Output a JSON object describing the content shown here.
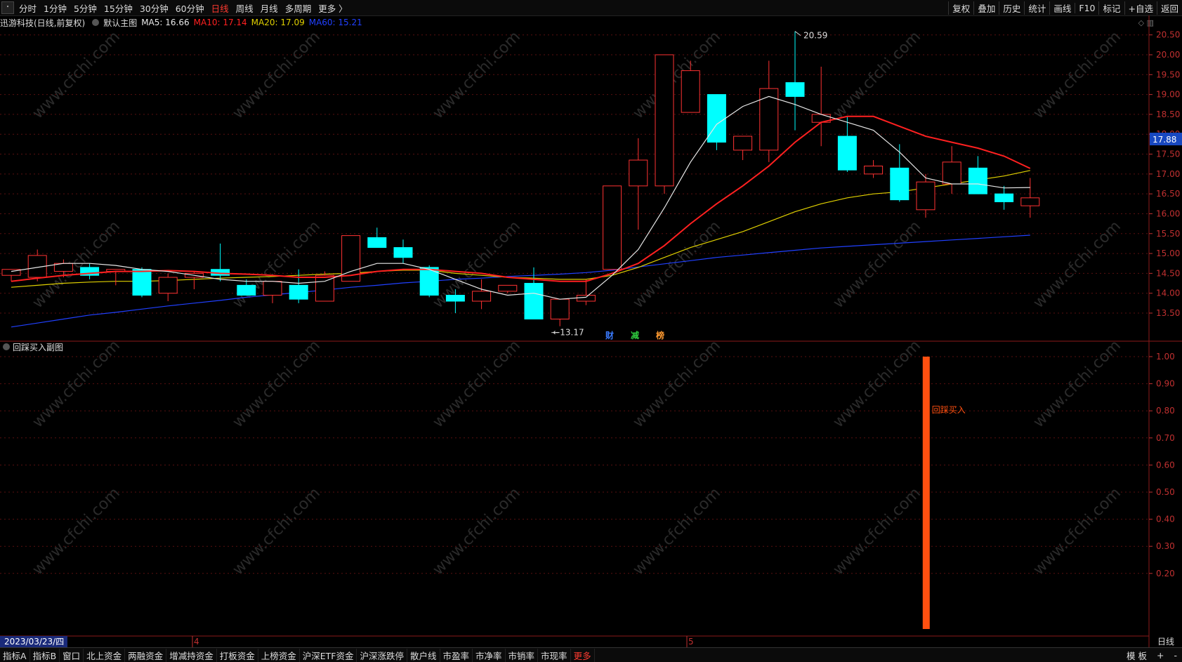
{
  "toolbar": {
    "corner": "・",
    "tabs": [
      "分时",
      "1分钟",
      "5分钟",
      "15分钟",
      "30分钟",
      "60分钟",
      "日线",
      "周线",
      "月线",
      "多周期",
      "更多 〉"
    ],
    "active_tab": "日线",
    "right_buttons": [
      "复权",
      "叠加",
      "历史",
      "统计",
      "画线",
      "F10",
      "标记",
      "+自选",
      "返回"
    ]
  },
  "main_info": {
    "stock": "迅游科技(日线,前复权)",
    "template": "默认主图",
    "ma5": "MA5: 16.66",
    "ma10": "MA10: 17.14",
    "ma20": "MA20: 17.09",
    "ma60": "MA60: 15.21",
    "colors": {
      "ma5": "#e8e8e8",
      "ma10": "#ff2020",
      "ma20": "#e0d000",
      "ma60": "#2040ff"
    }
  },
  "sub_info": {
    "title": "回踩买入副图"
  },
  "bottom": {
    "date": "2023/03/23/四",
    "month_marks": [
      "4",
      "5"
    ],
    "period_label": "日线",
    "tabs": [
      "指标A",
      "指标B",
      "窗口",
      "北上资金",
      "两融资金",
      "增减持资金",
      "打板资金",
      "上榜资金",
      "沪深ETF资金",
      "沪深涨跌停",
      "散户线",
      "市盈率",
      "市净率",
      "市销率",
      "市现率",
      "更多"
    ],
    "active_tab": "更多",
    "right": [
      "模 板",
      "+",
      "-"
    ]
  },
  "watermark": "www.cfchi.com",
  "chart_data": [
    {
      "type": "candlestick",
      "title": "迅游科技(日线,前复权)",
      "y_ticks": [
        "20.50",
        "20.00",
        "19.50",
        "19.00",
        "18.50",
        "18.00",
        "17.50",
        "17.00",
        "16.50",
        "16.00",
        "15.50",
        "15.00",
        "14.50",
        "14.00",
        "13.50"
      ],
      "ylim": [
        13.0,
        20.9
      ],
      "last_price": "17.88",
      "annotations": {
        "high": "20.59",
        "low": "13.17",
        "events": [
          "财",
          "减",
          "榜"
        ]
      },
      "candles": [
        {
          "o": 14.45,
          "h": 14.55,
          "l": 14.3,
          "c": 14.6
        },
        {
          "o": 14.4,
          "h": 15.1,
          "l": 14.3,
          "c": 14.95
        },
        {
          "o": 14.55,
          "h": 14.85,
          "l": 14.4,
          "c": 14.75
        },
        {
          "o": 14.65,
          "h": 14.75,
          "l": 14.35,
          "c": 14.45
        },
        {
          "o": 14.55,
          "h": 14.6,
          "l": 14.2,
          "c": 14.6
        },
        {
          "o": 14.6,
          "h": 14.65,
          "l": 13.9,
          "c": 13.95
        },
        {
          "o": 14.0,
          "h": 14.5,
          "l": 13.8,
          "c": 14.4
        },
        {
          "o": 14.4,
          "h": 14.55,
          "l": 14.1,
          "c": 14.5
        },
        {
          "o": 14.6,
          "h": 15.25,
          "l": 14.3,
          "c": 14.45
        },
        {
          "o": 14.2,
          "h": 14.35,
          "l": 13.95,
          "c": 13.95
        },
        {
          "o": 13.95,
          "h": 14.3,
          "l": 13.75,
          "c": 14.3
        },
        {
          "o": 14.2,
          "h": 14.6,
          "l": 13.75,
          "c": 13.85
        },
        {
          "o": 13.8,
          "h": 14.55,
          "l": 13.8,
          "c": 14.45
        },
        {
          "o": 14.3,
          "h": 15.05,
          "l": 14.3,
          "c": 15.45
        },
        {
          "o": 15.4,
          "h": 15.65,
          "l": 15.15,
          "c": 15.15
        },
        {
          "o": 15.15,
          "h": 15.35,
          "l": 14.75,
          "c": 14.9
        },
        {
          "o": 14.65,
          "h": 14.7,
          "l": 13.9,
          "c": 13.95
        },
        {
          "o": 13.95,
          "h": 14.1,
          "l": 13.5,
          "c": 13.8
        },
        {
          "o": 13.8,
          "h": 14.35,
          "l": 13.6,
          "c": 14.05
        },
        {
          "o": 14.05,
          "h": 14.2,
          "l": 14.0,
          "c": 14.2
        },
        {
          "o": 14.25,
          "h": 14.65,
          "l": 13.4,
          "c": 13.35
        },
        {
          "o": 13.35,
          "h": 13.85,
          "l": 13.17,
          "c": 13.85
        },
        {
          "o": 13.8,
          "h": 14.35,
          "l": 13.7,
          "c": 13.95
        },
        {
          "o": 14.6,
          "h": 16.7,
          "l": 14.6,
          "c": 16.7
        },
        {
          "o": 16.7,
          "h": 17.9,
          "l": 15.6,
          "c": 17.35
        },
        {
          "o": 16.7,
          "h": 20.0,
          "l": 16.5,
          "c": 20.0
        },
        {
          "o": 18.55,
          "h": 19.85,
          "l": 18.55,
          "c": 19.6
        },
        {
          "o": 19.0,
          "h": 19.0,
          "l": 17.6,
          "c": 17.8
        },
        {
          "o": 17.6,
          "h": 17.95,
          "l": 17.35,
          "c": 17.95
        },
        {
          "o": 17.6,
          "h": 19.85,
          "l": 17.3,
          "c": 19.15
        },
        {
          "o": 19.3,
          "h": 20.59,
          "l": 18.1,
          "c": 18.95
        },
        {
          "o": 18.3,
          "h": 19.7,
          "l": 17.7,
          "c": 18.5
        },
        {
          "o": 17.95,
          "h": 18.45,
          "l": 17.05,
          "c": 17.1
        },
        {
          "o": 17.0,
          "h": 17.35,
          "l": 16.9,
          "c": 17.2
        },
        {
          "o": 17.15,
          "h": 17.75,
          "l": 16.3,
          "c": 16.35
        },
        {
          "o": 16.1,
          "h": 17.0,
          "l": 15.9,
          "c": 16.8
        },
        {
          "o": 16.75,
          "h": 17.7,
          "l": 16.5,
          "c": 17.3
        },
        {
          "o": 17.15,
          "h": 17.45,
          "l": 16.5,
          "c": 16.5
        },
        {
          "o": 16.5,
          "h": 16.7,
          "l": 16.1,
          "c": 16.3
        },
        {
          "o": 16.2,
          "h": 16.9,
          "l": 15.9,
          "c": 16.4
        }
      ],
      "ma5": [
        14.55,
        14.65,
        14.75,
        14.75,
        14.7,
        14.6,
        14.55,
        14.45,
        14.35,
        14.3,
        14.3,
        14.25,
        14.3,
        14.55,
        14.75,
        14.75,
        14.6,
        14.35,
        14.1,
        13.95,
        14.0,
        13.85,
        13.9,
        14.45,
        15.1,
        16.15,
        17.3,
        18.25,
        18.7,
        18.95,
        18.75,
        18.5,
        18.3,
        18.1,
        17.55,
        16.9,
        16.75,
        16.75,
        16.65,
        16.66
      ],
      "ma10": [
        14.3,
        14.38,
        14.45,
        14.5,
        14.55,
        14.55,
        14.57,
        14.55,
        14.5,
        14.48,
        14.45,
        14.4,
        14.4,
        14.45,
        14.55,
        14.6,
        14.6,
        14.55,
        14.5,
        14.4,
        14.35,
        14.3,
        14.3,
        14.5,
        14.75,
        15.2,
        15.75,
        16.25,
        16.7,
        17.2,
        17.8,
        18.3,
        18.45,
        18.45,
        18.2,
        17.95,
        17.8,
        17.65,
        17.45,
        17.14
      ],
      "ma20": [
        14.15,
        14.2,
        14.25,
        14.28,
        14.3,
        14.3,
        14.32,
        14.35,
        14.38,
        14.4,
        14.42,
        14.45,
        14.48,
        14.5,
        14.55,
        14.58,
        14.58,
        14.5,
        14.45,
        14.4,
        14.38,
        14.35,
        14.35,
        14.45,
        14.65,
        14.9,
        15.15,
        15.35,
        15.55,
        15.8,
        16.05,
        16.25,
        16.4,
        16.5,
        16.55,
        16.65,
        16.75,
        16.85,
        16.95,
        17.09
      ],
      "ma60": [
        13.15,
        13.25,
        13.35,
        13.45,
        13.52,
        13.6,
        13.68,
        13.75,
        13.82,
        13.9,
        13.96,
        14.02,
        14.08,
        14.15,
        14.2,
        14.26,
        14.3,
        14.35,
        14.38,
        14.42,
        14.45,
        14.48,
        14.52,
        14.58,
        14.66,
        14.74,
        14.82,
        14.9,
        14.96,
        15.02,
        15.08,
        15.14,
        15.18,
        15.22,
        15.26,
        15.3,
        15.34,
        15.38,
        15.42,
        15.46
      ]
    },
    {
      "type": "bar",
      "title": "回踩买入副图",
      "y_ticks": [
        "1.00",
        "0.90",
        "0.80",
        "0.70",
        "0.60",
        "0.50",
        "0.40",
        "0.30",
        "0.20"
      ],
      "ylim": [
        0,
        1.0
      ],
      "signal_label": "回踩买入",
      "signal_index": 34,
      "signal_value": 1.0,
      "bar_color": "#ff5010"
    }
  ]
}
